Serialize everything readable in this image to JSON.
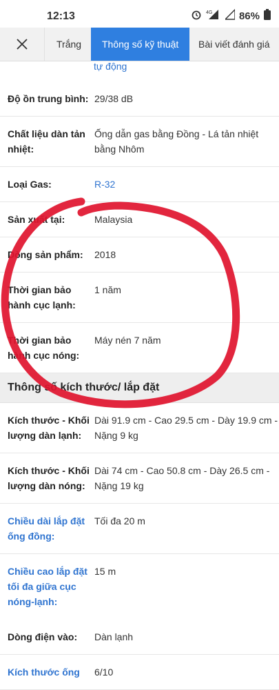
{
  "status": {
    "time": "12:13",
    "battery": "86%",
    "network": "4G"
  },
  "tabs": {
    "tab1": "Trắng",
    "active": "Thông số kỹ thuật",
    "tab3": "Bài viết đánh giá"
  },
  "snippet_top": "tự động",
  "rows_a": [
    {
      "k": "Độ ồn trung bình:",
      "v": "29/38 dB"
    },
    {
      "k": "Chất liệu dàn tản nhiệt:",
      "v": "Ống dẫn gas bằng Đồng - Lá tản nhiệt bằng Nhôm"
    },
    {
      "k": "Loại Gas:",
      "v": "R-32"
    },
    {
      "k": "Sản xuất tại:",
      "v": "Malaysia"
    },
    {
      "k": "Dòng sản phẩm:",
      "v": "2018"
    },
    {
      "k": "Thời gian bảo hành cục lạnh:",
      "v": "1 năm"
    },
    {
      "k": "Thời gian bảo hành cục nóng:",
      "v": "Máy nén 7 năm"
    }
  ],
  "section_title": "Thông số kích thước/ lắp đặt",
  "rows_b": [
    {
      "k": "Kích thước - Khối lượng dàn lạnh:",
      "v": "Dài 91.9 cm - Cao 29.5 cm - Dày 19.9 cm - Nặng 9 kg"
    },
    {
      "k": "Kích thước - Khối lượng dàn nóng:",
      "v": "Dài 74 cm - Cao 50.8 cm - Dày 26.5 cm - Nặng 19 kg"
    },
    {
      "k": "Chiều dài lắp đặt ống đồng:",
      "v": "Tối đa 20 m"
    },
    {
      "k": "Chiều cao lắp đặt tối đa giữa cục nóng-lạnh:",
      "v": "15 m"
    },
    {
      "k": "Dòng điện vào:",
      "v": "Dàn lạnh"
    },
    {
      "k": "Kích thước ống",
      "v": "6/10"
    }
  ]
}
